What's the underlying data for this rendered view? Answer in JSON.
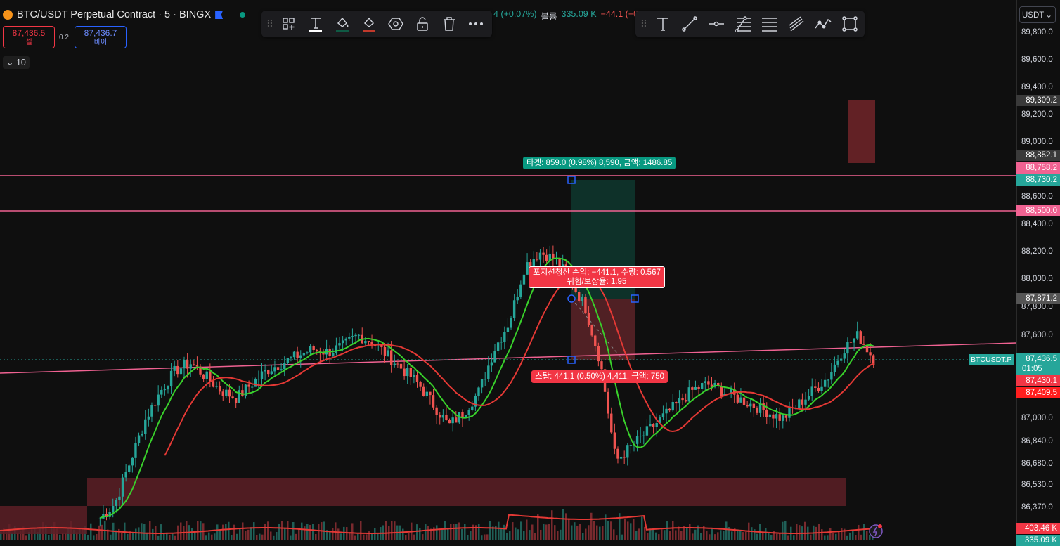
{
  "header": {
    "title": "BTC/USDT Perpetual Contract · 5 · BINGX",
    "ohlc": {
      "change": "4 (+0.07%)",
      "volume_label": "볼륨",
      "volume_value": "335.09 K",
      "vol_change": "−44.1 (−0"
    }
  },
  "trade": {
    "sell_price": "87,436.5",
    "sell_label": "셀",
    "spread": "0.2",
    "buy_price": "87,436.7",
    "buy_label": "바이",
    "interval_toggle": "10"
  },
  "toolbar_left": {
    "tools": [
      "drag-grip",
      "add-template",
      "text-tool",
      "fill-color",
      "line-color",
      "settings",
      "unlock",
      "delete",
      "more"
    ]
  },
  "toolbar_right": {
    "tools": [
      "drag-grip",
      "text",
      "trend-line",
      "horizontal-ray",
      "fib-retracement",
      "parallel-lines",
      "channel",
      "path",
      "rectangle"
    ]
  },
  "currency": "USDT",
  "price_ticks": [
    "89,800.0",
    "89,600.0",
    "89,400.0",
    "89,200.0",
    "89,000.0",
    "88,600.0",
    "88,400.0",
    "88,200.0",
    "88,000.0",
    "87,800.0",
    "87,600.0",
    "87,000.0",
    "86,840.0",
    "86,680.0",
    "86,530.0",
    "86,370.0"
  ],
  "price_labels": [
    {
      "text": "89,309.2",
      "color": "#3a3a3a"
    },
    {
      "text": "88,852.1",
      "color": "#3a3a3a"
    },
    {
      "text": "88,758.2",
      "color": "#f06292"
    },
    {
      "text": "88,730.2",
      "color": "#26a69a"
    },
    {
      "text": "88,500.0",
      "color": "#f06292"
    },
    {
      "text": "87,871.2",
      "color": "#555555"
    },
    {
      "text": "87,436.5",
      "color": "#26a69a",
      "extra": "01:05"
    },
    {
      "text": "87,430.1",
      "color": "#f23645"
    },
    {
      "text": "87,409.5",
      "color": "#f23645"
    },
    {
      "text": "403.46 K",
      "color": "#f23645"
    },
    {
      "text": "335.09 K",
      "color": "#26a69a"
    }
  ],
  "symbol_tag": "BTCUSDT.P",
  "position": {
    "target_label": "타겟: 859.0 (0.98%) 8,590, 금액: 1486.85",
    "pnl_label_1": "포지션청산 손익: −441.1, 수량: 0.567",
    "pnl_label_2": "위험/보상율: 1.95",
    "stop_label": "스탑: 441.1 (0.50%) 4,411, 금액: 750"
  },
  "colors": {
    "up": "#26a69a",
    "down": "#ef5350",
    "ma_fast": "#39d12b",
    "ma_slow": "#e53935",
    "hline": "#f06292"
  },
  "chart_data": {
    "type": "candlestick",
    "symbol": "BTCUSDT.P",
    "timeframe": "5",
    "y_axis": {
      "min": 86300,
      "max": 89900,
      "scale": "non-linear"
    },
    "horizontal_lines": [
      88758.2,
      88500.0
    ],
    "long_position": {
      "entry": 87871.2,
      "target": 88730.2,
      "stop": 87430.1
    },
    "last_price": 87436.5,
    "candles_close_approx": [
      86300,
      86400,
      86700,
      87000,
      87200,
      87350,
      87400,
      87300,
      87200,
      87150,
      87250,
      87350,
      87400,
      87450,
      87500,
      87480,
      87520,
      87600,
      87550,
      87450,
      87350,
      87250,
      87100,
      86950,
      87050,
      87200,
      87500,
      87700,
      88100,
      88200,
      88150,
      88000,
      87800,
      87400,
      86700,
      86800,
      86900,
      87000,
      87100,
      87200,
      87250,
      87200,
      87150,
      87100,
      87050,
      87000,
      87100,
      87200,
      87300,
      87500,
      87600,
      87430
    ]
  }
}
